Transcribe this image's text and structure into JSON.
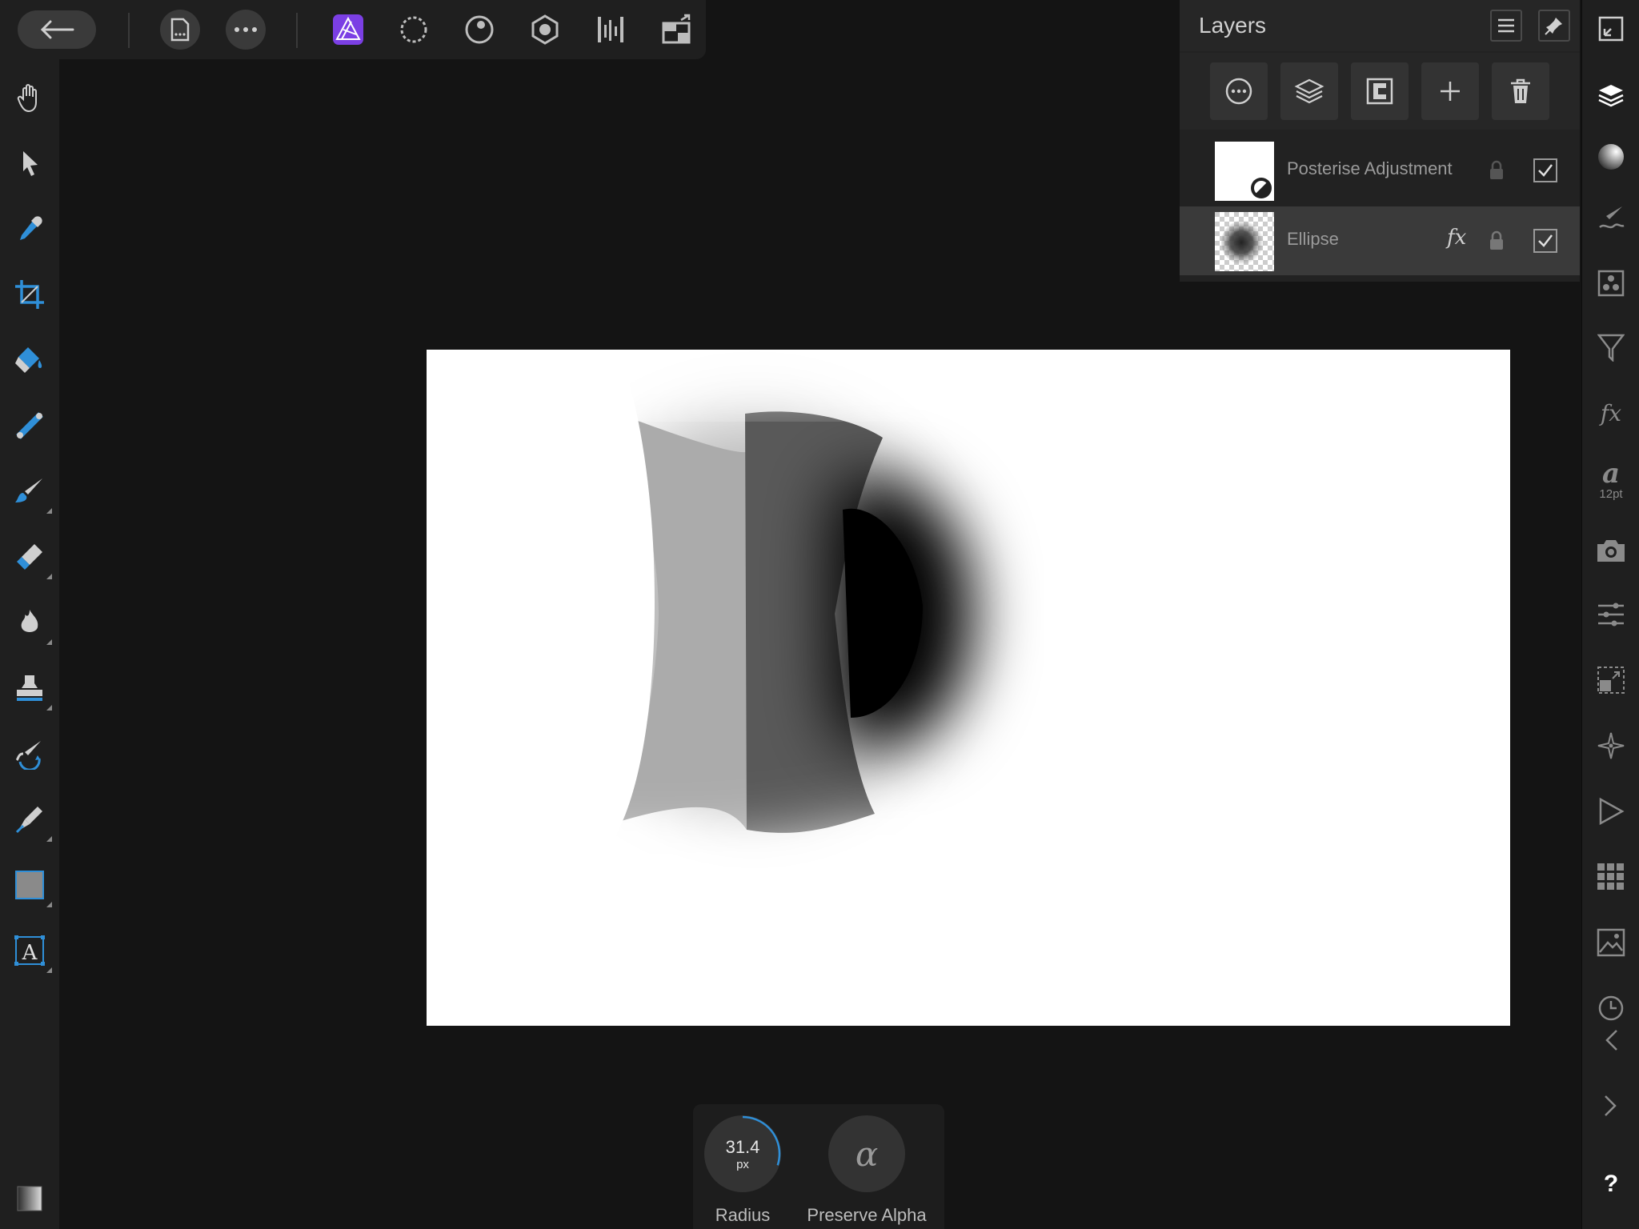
{
  "layers_panel": {
    "title": "Layers",
    "layers": [
      {
        "name": "Posterise Adjustment",
        "visible": true
      },
      {
        "name": "Ellipse",
        "visible": true,
        "has_fx": true
      }
    ],
    "fx_label": "fx"
  },
  "context_toolbar": {
    "radius_value": "31.4",
    "radius_unit": "px",
    "radius_label": "Radius",
    "radius_fraction": 0.3,
    "preserve_alpha_label": "Preserve Alpha",
    "preserve_alpha_symbol": "α"
  },
  "right_bar": {
    "fx_label": "fx",
    "text_style_glyph": "a",
    "text_style_size": "12pt",
    "help_label": "?"
  },
  "left_bar": {
    "text_tool_glyph": "A"
  },
  "colors": {
    "accent": "#2f8fd8",
    "persona_active": "#7b3fe4",
    "panel": "#222222",
    "toolbar": "#1f1f1f",
    "canvas_bg": "#141414"
  }
}
